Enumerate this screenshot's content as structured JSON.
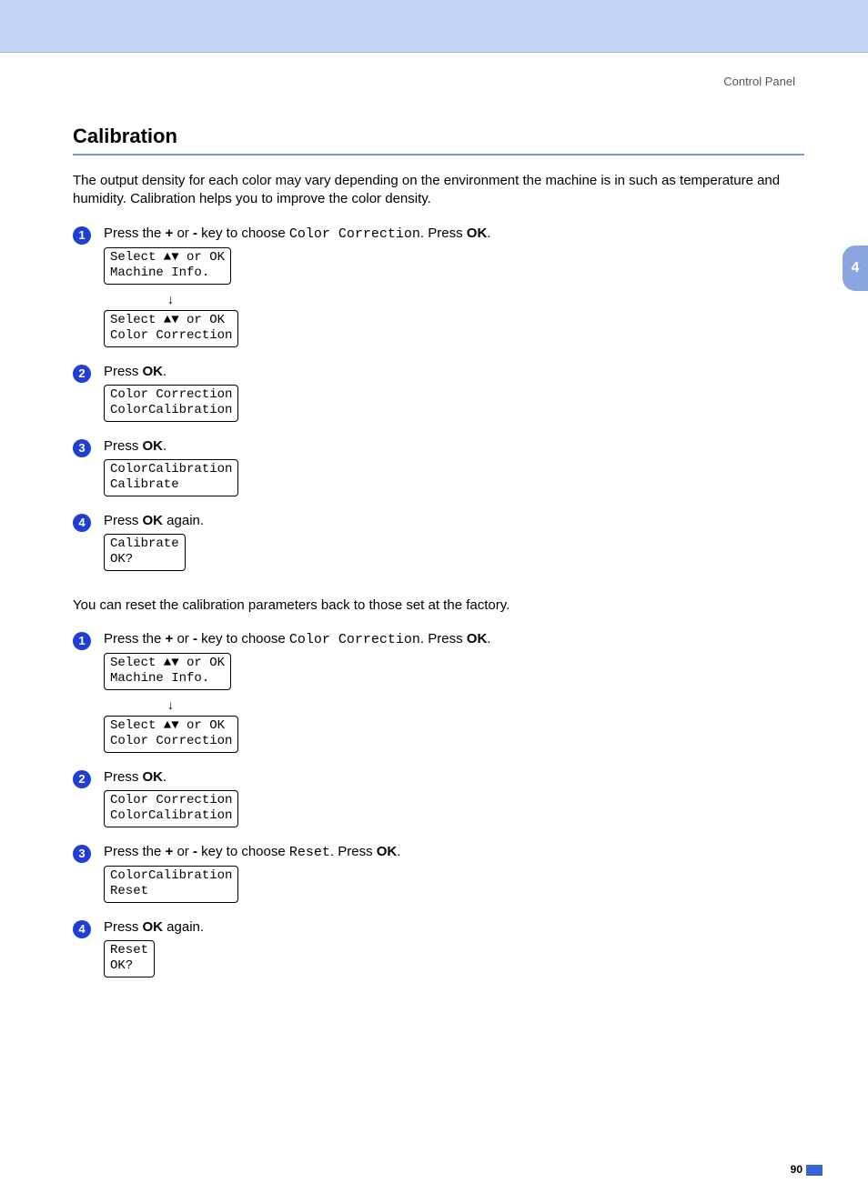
{
  "header": {
    "breadcrumb": "Control Panel"
  },
  "side_tab": "4",
  "page_number": "90",
  "section": {
    "title": "Calibration",
    "intro": "The output density for each color may vary depending on the environment the machine is in such as temperature and humidity. Calibration helps you to improve the color density.",
    "reset_intro": "You can reset the calibration parameters back to those set at the factory."
  },
  "common": {
    "press_plus_minus_prefix": "Press the ",
    "plus": "+",
    "or": " or ",
    "minus": "-",
    "key_to_choose": " key to choose ",
    "color_correction_mono": "Color Correction",
    "reset_mono": "Reset",
    "period_press": ". Press ",
    "ok": "OK",
    "period": ".",
    "press": "Press ",
    "again": " again."
  },
  "lcd": {
    "select_machine_info": "Select ▲▼ or OK\nMachine Info.",
    "select_color_correction": "Select ▲▼ or OK\nColor Correction",
    "cc_calibration": "Color Correction\nColorCalibration",
    "calib_calibrate": "ColorCalibration\nCalibrate",
    "calibrate_ok": "Calibrate\nOK?",
    "calib_reset": "ColorCalibration\nReset",
    "reset_ok": "Reset\nOK?"
  },
  "bullets": {
    "b1": "1",
    "b2": "2",
    "b3": "3",
    "b4": "4"
  },
  "arrow": "↓"
}
